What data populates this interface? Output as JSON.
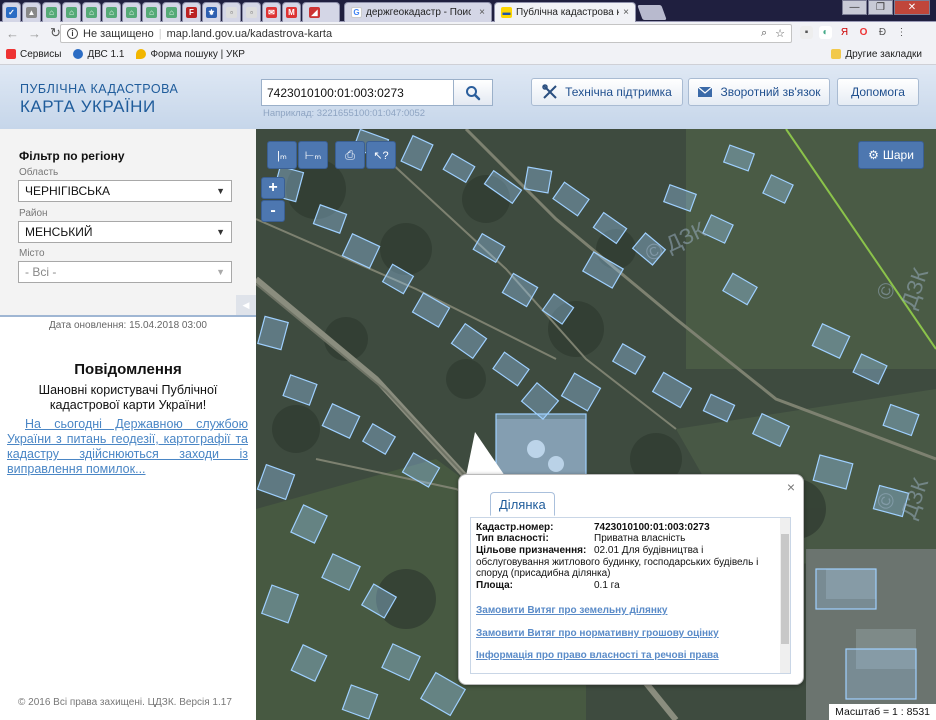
{
  "browser": {
    "tabs": [
      {
        "title": ""
      },
      {
        "title": ""
      },
      {
        "title": ""
      },
      {
        "title": ""
      },
      {
        "title": ""
      },
      {
        "title": ""
      },
      {
        "title": ""
      },
      {
        "title": ""
      },
      {
        "title": ""
      },
      {
        "title": ""
      },
      {
        "title": ""
      },
      {
        "title": ""
      },
      {
        "title": ""
      },
      {
        "title": ""
      },
      {
        "title": ""
      },
      {
        "title": "держгеокадастр - Поис",
        "close": "×"
      },
      {
        "title": "Публічна кадастрова ка",
        "close": "×"
      }
    ],
    "security_label": "Не защищено",
    "url": "map.land.gov.ua/kadastrova-karta",
    "bookmarks": [
      {
        "label": "Сервисы"
      },
      {
        "label": "ДВС 1.1"
      },
      {
        "label": "Форма пошуку | УКР"
      }
    ],
    "other_bookmarks": "Другие закладки"
  },
  "header": {
    "logo_line1": "ПУБЛІЧНА КАДАСТРОВА",
    "logo_line2": "КАРТА УКРАЇНИ",
    "search_value": "7423010100:01:003:0273",
    "search_hint": "Наприклад: 3221655100:01:047:0052",
    "support_label": "Технічна підтримка",
    "feedback_label": "Зворотний зв'язок",
    "help_label": "Допомога"
  },
  "filter": {
    "title": "Фільтр по регіону",
    "oblast_label": "Область",
    "oblast_value": "ЧЕРНІГІВСЬКА",
    "raion_label": "Район",
    "raion_value": "МЕНСЬКИЙ",
    "misto_label": "Місто",
    "misto_value": "- Всі -"
  },
  "update_date": "Дата оновлення: 15.04.2018 03:00",
  "news": {
    "title": "Повідомлення",
    "greeting": "Шановні користувачі Публічної кадастрової карти України!",
    "link": "На сьогодні Державною службою України з питань геодезії, картографії та кадастру здійснюються заходи із виправлення помилок..."
  },
  "copyright": "© 2016 Всі права захищені. ЦДЗК. Версія 1.17",
  "map": {
    "layers_label": "Шари",
    "zoom_in": "+",
    "zoom_out": "-",
    "scale": "Масштаб = 1 : 8531",
    "watermark": "© ДЗК"
  },
  "popup": {
    "tab": "Ділянка",
    "close": "×",
    "cadastral_key": "Кадастр.номер:",
    "cadastral_value": "7423010100:01:003:0273",
    "ownership_key": "Тип власності:",
    "ownership_value": "Приватна власність",
    "purpose_key": "Цільове призначення:",
    "purpose_value": "02.01 Для будівництва і обслуговування житлового будинку, господарських будівель і споруд (присадибна ділянка)",
    "area_key": "Площа:",
    "area_value": "0.1 га",
    "link1": "Замовити Витяг про земельну ділянку",
    "link2": "Замовити Витяг про нормативну грошову оцінку",
    "link3": "Інформація про право власності та речові права"
  }
}
